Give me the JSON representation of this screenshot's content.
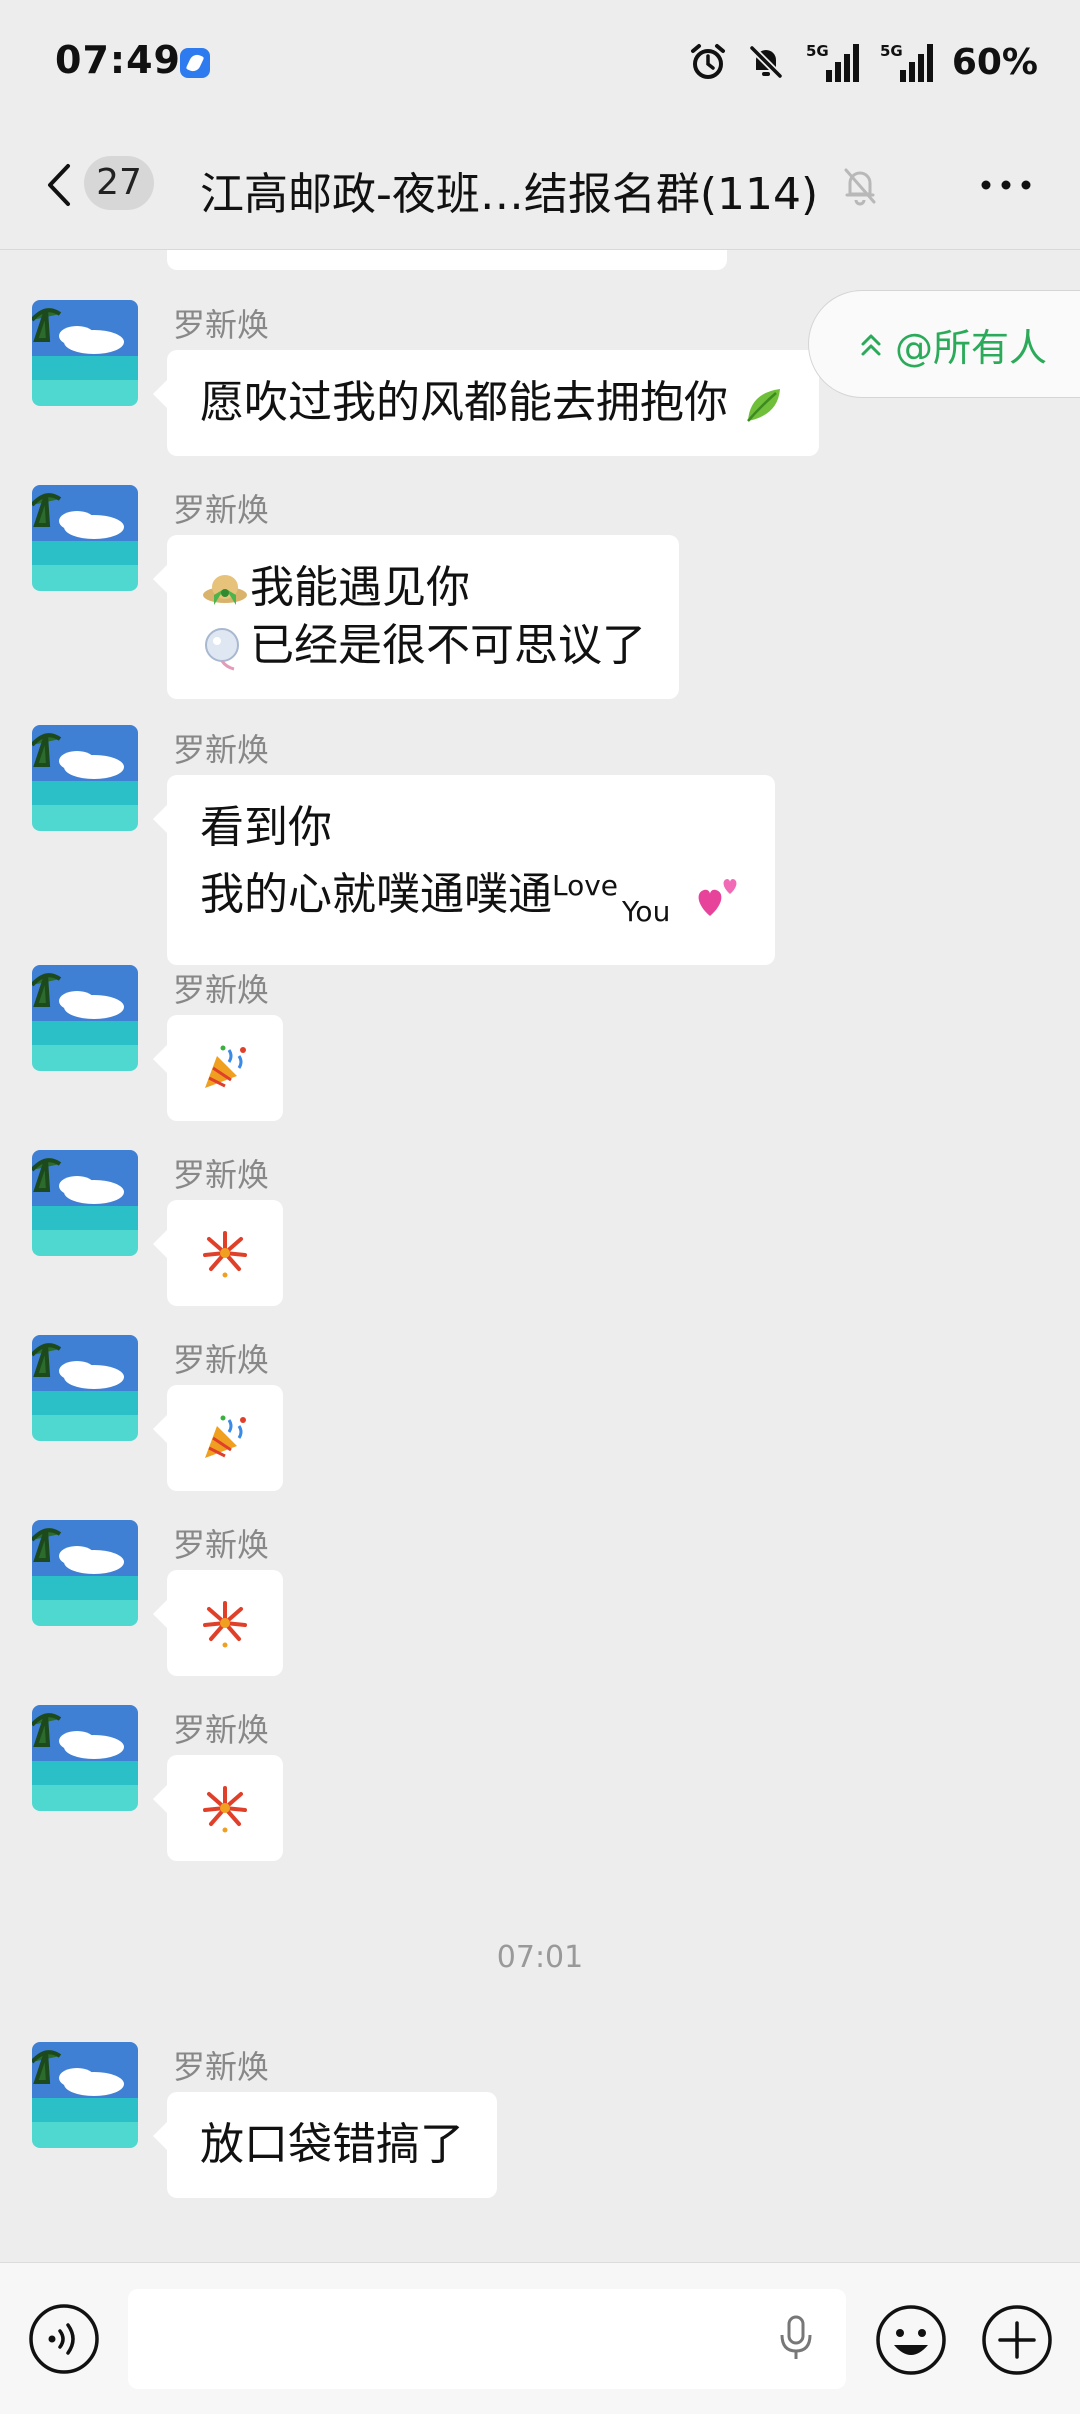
{
  "status_bar": {
    "time": "07:49",
    "signal_1_label": "5G",
    "signal_2_label": "5G",
    "battery": "60%"
  },
  "nav": {
    "unread_count": "27",
    "title": "江高邮政-夜班…结报名群(114)"
  },
  "mention": {
    "label": "@所有人"
  },
  "messages": [
    {
      "sender": "罗新焕",
      "line1": "愿吹过我的风都能去拥抱你",
      "emoji": "leaf"
    },
    {
      "sender": "罗新焕",
      "line1": "我能遇见你",
      "line2": "已经是很不可思议了"
    },
    {
      "sender": "罗新焕",
      "line1": "看到你",
      "line2": "我的心就噗通噗通",
      "sup": "Love",
      "sub": "You"
    },
    {
      "sender": "罗新焕",
      "emoji": "party-popper"
    },
    {
      "sender": "罗新焕",
      "emoji": "fireworks"
    },
    {
      "sender": "罗新焕",
      "emoji": "party-popper"
    },
    {
      "sender": "罗新焕",
      "emoji": "fireworks"
    },
    {
      "sender": "罗新焕",
      "emoji": "fireworks"
    },
    {
      "sender": "罗新焕",
      "line1": "放口袋错搞了"
    }
  ],
  "time_divider": "07:01",
  "colors": {
    "background": "#ededed",
    "bubble": "#ffffff",
    "accent_green": "#2bab5a",
    "sender_gray": "#888888"
  }
}
